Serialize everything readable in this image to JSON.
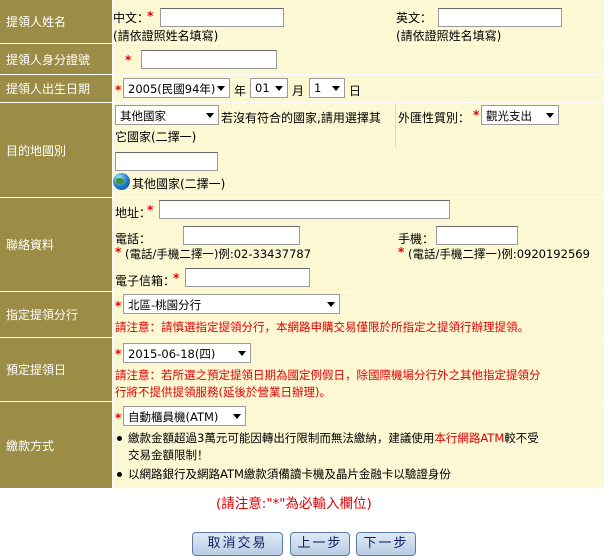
{
  "labels": {
    "name": "提領人姓名",
    "id": "提領人身分證號",
    "birth": "提領人出生日期",
    "dest": "目的地國別",
    "contact": "聯絡資料",
    "branch": "指定提領分行",
    "date": "預定提領日",
    "pay": "繳款方式"
  },
  "name": {
    "cn_label": "中文：",
    "cn_hint": "(請依證照姓名填寫)",
    "en_label": "英文：",
    "en_hint": "(請依證照姓名填寫)",
    "cn_value": "",
    "en_value": ""
  },
  "id": {
    "value": ""
  },
  "birth": {
    "year": "2005(民國94年)",
    "year_unit": "年",
    "month": "01",
    "month_unit": "月",
    "day": "1",
    "day_unit": "日"
  },
  "dest": {
    "country_select": "其他國家",
    "note1": "若沒有符合的國家,請用選擇其",
    "note2": "它國家(二擇一)",
    "foreign_label": "外匯性質別：",
    "foreign_select": "觀光支出",
    "other_input": "",
    "other_label": "其他國家(二擇一)"
  },
  "contact": {
    "addr_label": "地址：",
    "tel_label": "電話：",
    "tel_hint": "(電話/手機二擇一)例:02-33437787",
    "mobile_label": "手機：",
    "mobile_hint": "(電話/手機二擇一)例:0920192569",
    "email_label": "電子信箱："
  },
  "branch": {
    "select": "北區-桃園分行",
    "notice": "請注意：請慎選指定提領分行，本網路申購交易僅限於所指定之提領行辦理提領。"
  },
  "date": {
    "select": "2015-06-18(四)",
    "notice1": "請注意：若所選之預定提領日期為國定例假日，除國際機場分行外之其他指定提領分",
    "notice2": "行將不提供提領服務(延後於營業日辦理)。"
  },
  "pay": {
    "select": "自動櫃員機(ATM)",
    "b1_a": "繳款金額超過3萬元可能因轉出行限制而無法繳納，建議使用",
    "b1_link": "本行網路ATM",
    "b1_b": "較不受",
    "b1_c": "交易金額限制！",
    "b2": "以網路銀行及網路ATM繳款須備讀卡機及晶片金融卡以驗證身份"
  },
  "required_note": "(請注意:\"*\"為必輸入欄位)",
  "buttons": {
    "cancel": "取消交易",
    "prev": "上一步",
    "next": "下一步"
  }
}
